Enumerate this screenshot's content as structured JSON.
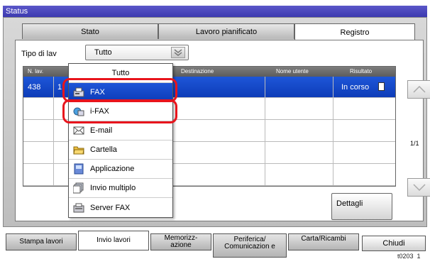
{
  "window": {
    "title": "Status"
  },
  "tabs": [
    {
      "label": "Stato"
    },
    {
      "label": "Lavoro pianificato"
    },
    {
      "label": "Registro"
    }
  ],
  "filter": {
    "label": "Tipo di lav",
    "value": "Tutto"
  },
  "columns": [
    "N. lav.",
    "Destinazione",
    "Nome utente",
    "Risultato"
  ],
  "rows": [
    {
      "num": "438",
      "num2": "1",
      "result": "In corso"
    }
  ],
  "dropdown": {
    "header": "Tutto",
    "items": [
      {
        "label": "FAX",
        "icon": "fax-icon",
        "selected": true
      },
      {
        "label": "i-FAX",
        "icon": "ifax-icon"
      },
      {
        "label": "E-mail",
        "icon": "email-icon"
      },
      {
        "label": "Cartella",
        "icon": "folder-icon"
      },
      {
        "label": "Applicazione",
        "icon": "application-icon"
      },
      {
        "label": "Invio multiplo",
        "icon": "multi-send-icon"
      },
      {
        "label": "Server FAX",
        "icon": "server-fax-icon"
      }
    ]
  },
  "pager": {
    "text": "1/1"
  },
  "details_button": "Dettagli",
  "bottom_tabs": [
    {
      "label": "Stampa lavori"
    },
    {
      "label": "Invio lavori",
      "active": true
    },
    {
      "label": "Memorizz- azione"
    },
    {
      "label": "Periferica/ Comunicazion e"
    },
    {
      "label": "Carta/Ricambi"
    }
  ],
  "close_button": "Chiudi",
  "footer_id": "t0203_1",
  "colors": {
    "title_bar": "#3c39b0",
    "selection": "#1e56d8",
    "highlight_circle": "#e8141c"
  }
}
